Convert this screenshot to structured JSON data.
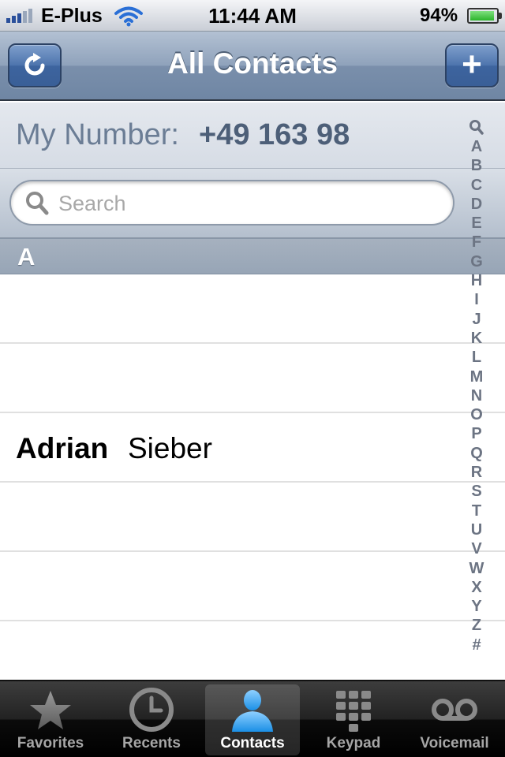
{
  "status_bar": {
    "carrier": "E-Plus",
    "time": "11:44 AM",
    "battery_percent": "94%",
    "battery_level": 0.94,
    "signal_bars": 5,
    "accent": "#2a4f9b"
  },
  "nav_bar": {
    "title": "All Contacts",
    "left_button_icon": "refresh-icon",
    "right_button_label": "+"
  },
  "my_number": {
    "label": "My Number:",
    "value": "+49 163 98"
  },
  "search": {
    "placeholder": "Search",
    "value": ""
  },
  "section": {
    "letter": "A"
  },
  "contacts": [
    {
      "first": "",
      "last": ""
    },
    {
      "first": "",
      "last": ""
    },
    {
      "first": "Adrian",
      "last": "Sieber"
    },
    {
      "first": "",
      "last": ""
    },
    {
      "first": "",
      "last": ""
    },
    {
      "first": "",
      "last": ""
    }
  ],
  "index_letters": [
    "A",
    "B",
    "C",
    "D",
    "E",
    "F",
    "G",
    "H",
    "I",
    "J",
    "K",
    "L",
    "M",
    "N",
    "O",
    "P",
    "Q",
    "R",
    "S",
    "T",
    "U",
    "V",
    "W",
    "X",
    "Y",
    "Z",
    "#"
  ],
  "tabs": [
    {
      "label": "Favorites",
      "icon": "star-icon",
      "active": false
    },
    {
      "label": "Recents",
      "icon": "clock-icon",
      "active": false
    },
    {
      "label": "Contacts",
      "icon": "person-icon",
      "active": true
    },
    {
      "label": "Keypad",
      "icon": "keypad-icon",
      "active": false
    },
    {
      "label": "Voicemail",
      "icon": "voicemail-icon",
      "active": false
    }
  ],
  "colors": {
    "nav_bar": "#7a8fab",
    "button": "#3d649f",
    "section_header": "#9facbc",
    "tab_active": "#3da4f0"
  }
}
